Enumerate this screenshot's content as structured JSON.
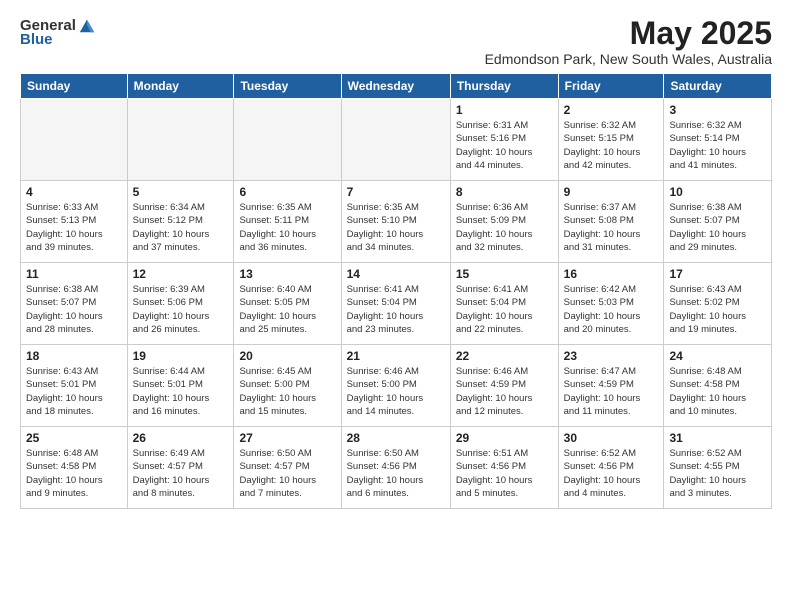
{
  "logo": {
    "line1": "General",
    "line2": "Blue"
  },
  "title": "May 2025",
  "location": "Edmondson Park, New South Wales, Australia",
  "headers": [
    "Sunday",
    "Monday",
    "Tuesday",
    "Wednesday",
    "Thursday",
    "Friday",
    "Saturday"
  ],
  "weeks": [
    [
      {
        "day": "",
        "info": ""
      },
      {
        "day": "",
        "info": ""
      },
      {
        "day": "",
        "info": ""
      },
      {
        "day": "",
        "info": ""
      },
      {
        "day": "1",
        "info": "Sunrise: 6:31 AM\nSunset: 5:16 PM\nDaylight: 10 hours\nand 44 minutes."
      },
      {
        "day": "2",
        "info": "Sunrise: 6:32 AM\nSunset: 5:15 PM\nDaylight: 10 hours\nand 42 minutes."
      },
      {
        "day": "3",
        "info": "Sunrise: 6:32 AM\nSunset: 5:14 PM\nDaylight: 10 hours\nand 41 minutes."
      }
    ],
    [
      {
        "day": "4",
        "info": "Sunrise: 6:33 AM\nSunset: 5:13 PM\nDaylight: 10 hours\nand 39 minutes."
      },
      {
        "day": "5",
        "info": "Sunrise: 6:34 AM\nSunset: 5:12 PM\nDaylight: 10 hours\nand 37 minutes."
      },
      {
        "day": "6",
        "info": "Sunrise: 6:35 AM\nSunset: 5:11 PM\nDaylight: 10 hours\nand 36 minutes."
      },
      {
        "day": "7",
        "info": "Sunrise: 6:35 AM\nSunset: 5:10 PM\nDaylight: 10 hours\nand 34 minutes."
      },
      {
        "day": "8",
        "info": "Sunrise: 6:36 AM\nSunset: 5:09 PM\nDaylight: 10 hours\nand 32 minutes."
      },
      {
        "day": "9",
        "info": "Sunrise: 6:37 AM\nSunset: 5:08 PM\nDaylight: 10 hours\nand 31 minutes."
      },
      {
        "day": "10",
        "info": "Sunrise: 6:38 AM\nSunset: 5:07 PM\nDaylight: 10 hours\nand 29 minutes."
      }
    ],
    [
      {
        "day": "11",
        "info": "Sunrise: 6:38 AM\nSunset: 5:07 PM\nDaylight: 10 hours\nand 28 minutes."
      },
      {
        "day": "12",
        "info": "Sunrise: 6:39 AM\nSunset: 5:06 PM\nDaylight: 10 hours\nand 26 minutes."
      },
      {
        "day": "13",
        "info": "Sunrise: 6:40 AM\nSunset: 5:05 PM\nDaylight: 10 hours\nand 25 minutes."
      },
      {
        "day": "14",
        "info": "Sunrise: 6:41 AM\nSunset: 5:04 PM\nDaylight: 10 hours\nand 23 minutes."
      },
      {
        "day": "15",
        "info": "Sunrise: 6:41 AM\nSunset: 5:04 PM\nDaylight: 10 hours\nand 22 minutes."
      },
      {
        "day": "16",
        "info": "Sunrise: 6:42 AM\nSunset: 5:03 PM\nDaylight: 10 hours\nand 20 minutes."
      },
      {
        "day": "17",
        "info": "Sunrise: 6:43 AM\nSunset: 5:02 PM\nDaylight: 10 hours\nand 19 minutes."
      }
    ],
    [
      {
        "day": "18",
        "info": "Sunrise: 6:43 AM\nSunset: 5:01 PM\nDaylight: 10 hours\nand 18 minutes."
      },
      {
        "day": "19",
        "info": "Sunrise: 6:44 AM\nSunset: 5:01 PM\nDaylight: 10 hours\nand 16 minutes."
      },
      {
        "day": "20",
        "info": "Sunrise: 6:45 AM\nSunset: 5:00 PM\nDaylight: 10 hours\nand 15 minutes."
      },
      {
        "day": "21",
        "info": "Sunrise: 6:46 AM\nSunset: 5:00 PM\nDaylight: 10 hours\nand 14 minutes."
      },
      {
        "day": "22",
        "info": "Sunrise: 6:46 AM\nSunset: 4:59 PM\nDaylight: 10 hours\nand 12 minutes."
      },
      {
        "day": "23",
        "info": "Sunrise: 6:47 AM\nSunset: 4:59 PM\nDaylight: 10 hours\nand 11 minutes."
      },
      {
        "day": "24",
        "info": "Sunrise: 6:48 AM\nSunset: 4:58 PM\nDaylight: 10 hours\nand 10 minutes."
      }
    ],
    [
      {
        "day": "25",
        "info": "Sunrise: 6:48 AM\nSunset: 4:58 PM\nDaylight: 10 hours\nand 9 minutes."
      },
      {
        "day": "26",
        "info": "Sunrise: 6:49 AM\nSunset: 4:57 PM\nDaylight: 10 hours\nand 8 minutes."
      },
      {
        "day": "27",
        "info": "Sunrise: 6:50 AM\nSunset: 4:57 PM\nDaylight: 10 hours\nand 7 minutes."
      },
      {
        "day": "28",
        "info": "Sunrise: 6:50 AM\nSunset: 4:56 PM\nDaylight: 10 hours\nand 6 minutes."
      },
      {
        "day": "29",
        "info": "Sunrise: 6:51 AM\nSunset: 4:56 PM\nDaylight: 10 hours\nand 5 minutes."
      },
      {
        "day": "30",
        "info": "Sunrise: 6:52 AM\nSunset: 4:56 PM\nDaylight: 10 hours\nand 4 minutes."
      },
      {
        "day": "31",
        "info": "Sunrise: 6:52 AM\nSunset: 4:55 PM\nDaylight: 10 hours\nand 3 minutes."
      }
    ]
  ]
}
